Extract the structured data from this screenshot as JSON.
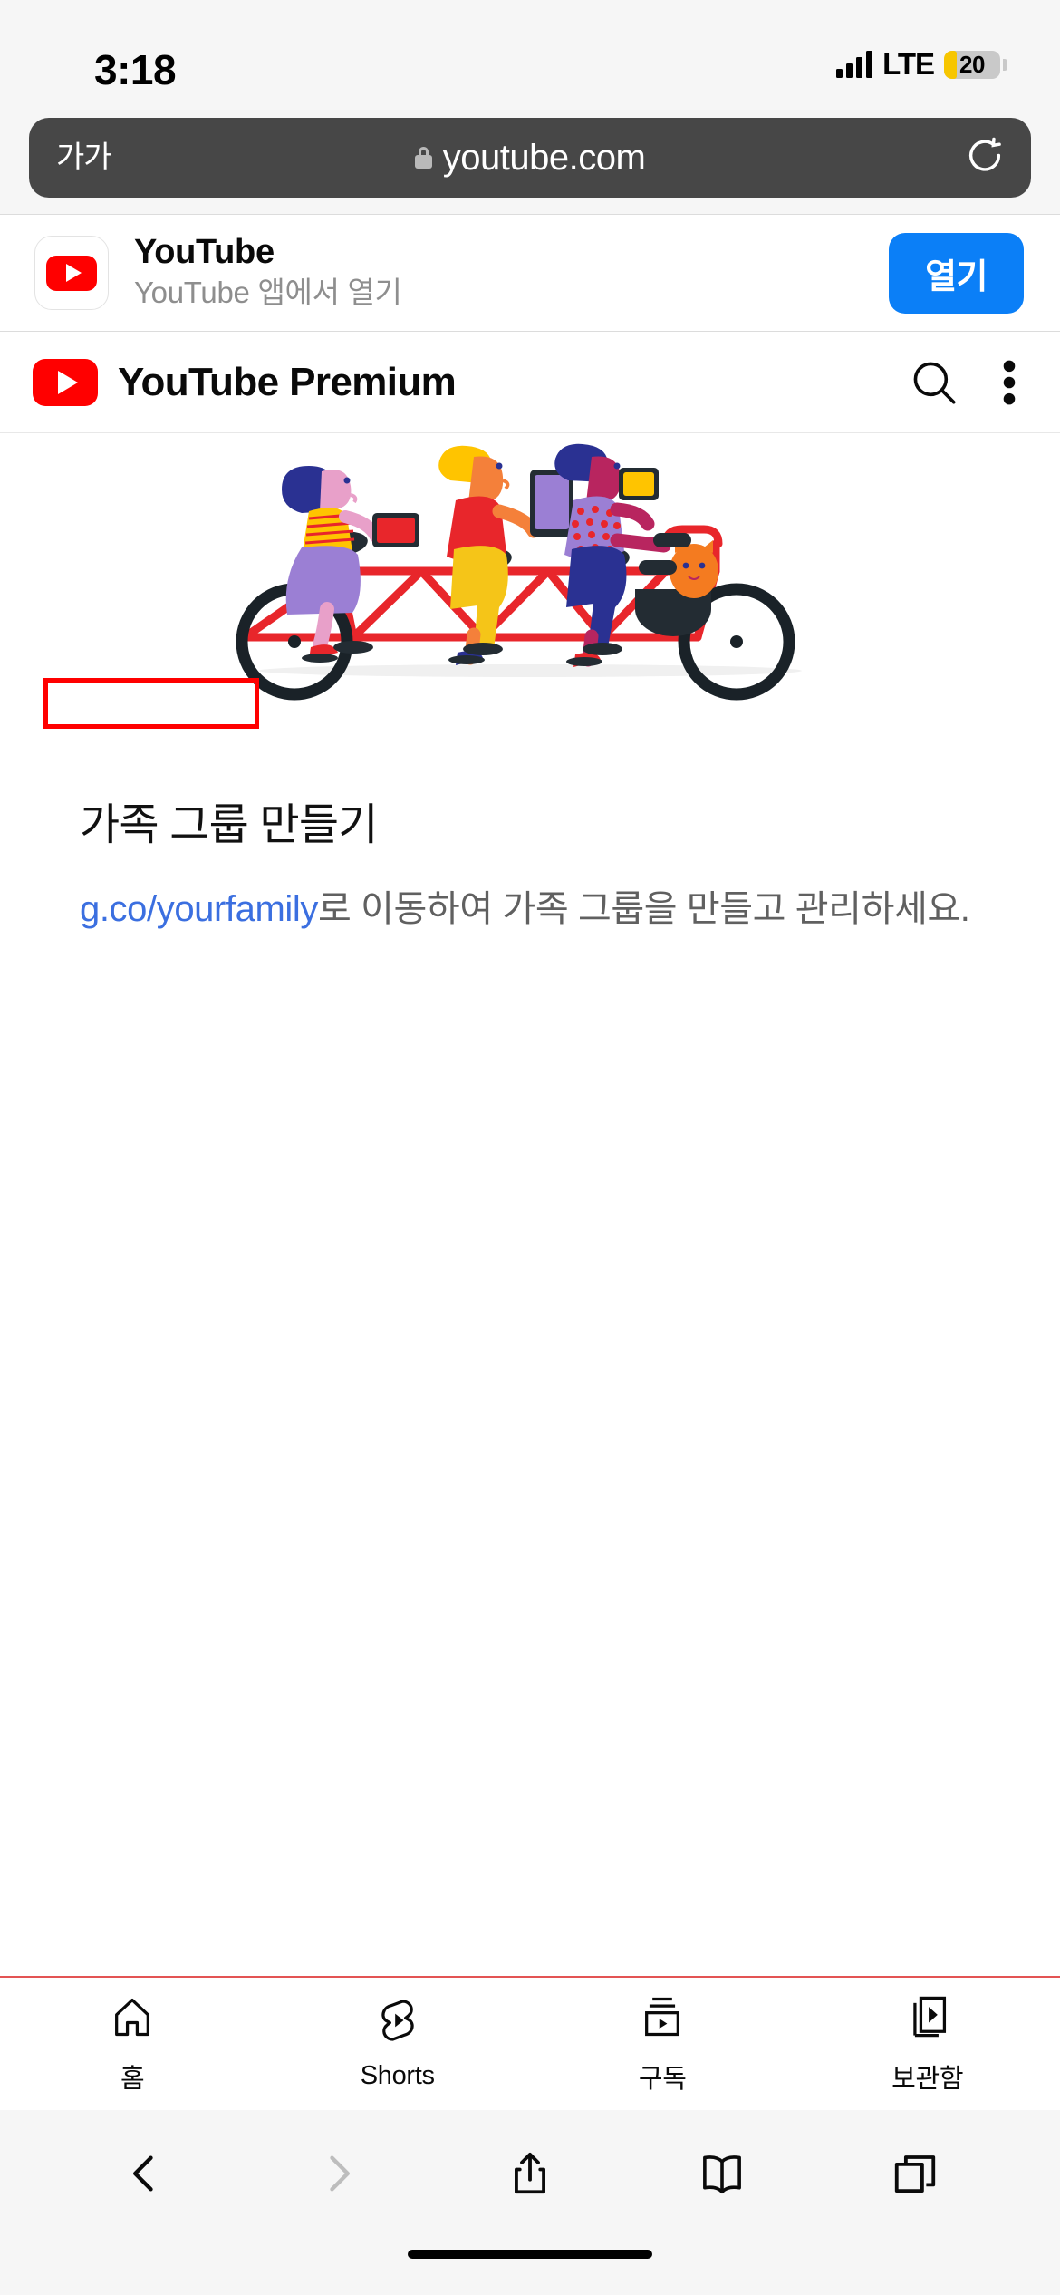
{
  "status_bar": {
    "time": "3:18",
    "network_label": "LTE",
    "battery_percent": "20",
    "battery_fill_color": "#f7c600",
    "signal_bars": 4
  },
  "browser": {
    "text_size_button": "가가",
    "url": "youtube.com",
    "secure_icon": "lock-icon",
    "reload_icon": "reload-icon"
  },
  "app_banner": {
    "app_name": "YouTube",
    "subtitle": "YouTube 앱에서 열기",
    "open_button": "열기",
    "open_button_color": "#0b7ff7",
    "icon": "youtube-app-icon"
  },
  "youtube_header": {
    "brand": "YouTube Premium",
    "brand_color": "#ff0000",
    "search_icon": "search-icon",
    "more_icon": "more-vertical-icon"
  },
  "page": {
    "illustration": {
      "name": "tandem-bicycle-family-illustration",
      "description": "Three riders on a red tandem bicycle holding devices, with an orange cat in the front basket",
      "colors": {
        "bike": "#e8262b",
        "rider1_skirt": "#9b7fd4",
        "rider1_top": "#ffc400",
        "rider1_hair": "#2a3192",
        "rider2_shirt": "#e8262b",
        "rider2_pants": "#f5c518",
        "rider2_hair": "#ffc400",
        "rider3_pants": "#2a3192",
        "rider3_hair": "#2a3192",
        "cat": "#f47b20",
        "basket": "#232c33",
        "wheel": "#1a2228",
        "tablet_red": "#e8262b",
        "tablet_purple": "#9b7fd4",
        "tablet_yellow": "#ffc400"
      }
    },
    "section_title": "가족 그룹 만들기",
    "body_link_text": "g.co/yourfamily",
    "body_text_after_link": "로 이동하여 가족 그룹을 만들고 관리하세요.",
    "link_color": "#3b6fe0",
    "annotation_box_color": "#ff0000"
  },
  "youtube_tabbar": {
    "tabs": [
      {
        "label": "홈",
        "icon": "home-icon"
      },
      {
        "label": "Shorts",
        "icon": "shorts-icon"
      },
      {
        "label": "구독",
        "icon": "subscriptions-icon"
      },
      {
        "label": "보관함",
        "icon": "library-icon"
      }
    ]
  },
  "safari_toolbar": {
    "items": [
      {
        "icon": "back-chevron-icon",
        "enabled": true
      },
      {
        "icon": "forward-chevron-icon",
        "enabled": false
      },
      {
        "icon": "share-icon",
        "enabled": true
      },
      {
        "icon": "bookmarks-icon",
        "enabled": true
      },
      {
        "icon": "tabs-icon",
        "enabled": true
      }
    ]
  }
}
